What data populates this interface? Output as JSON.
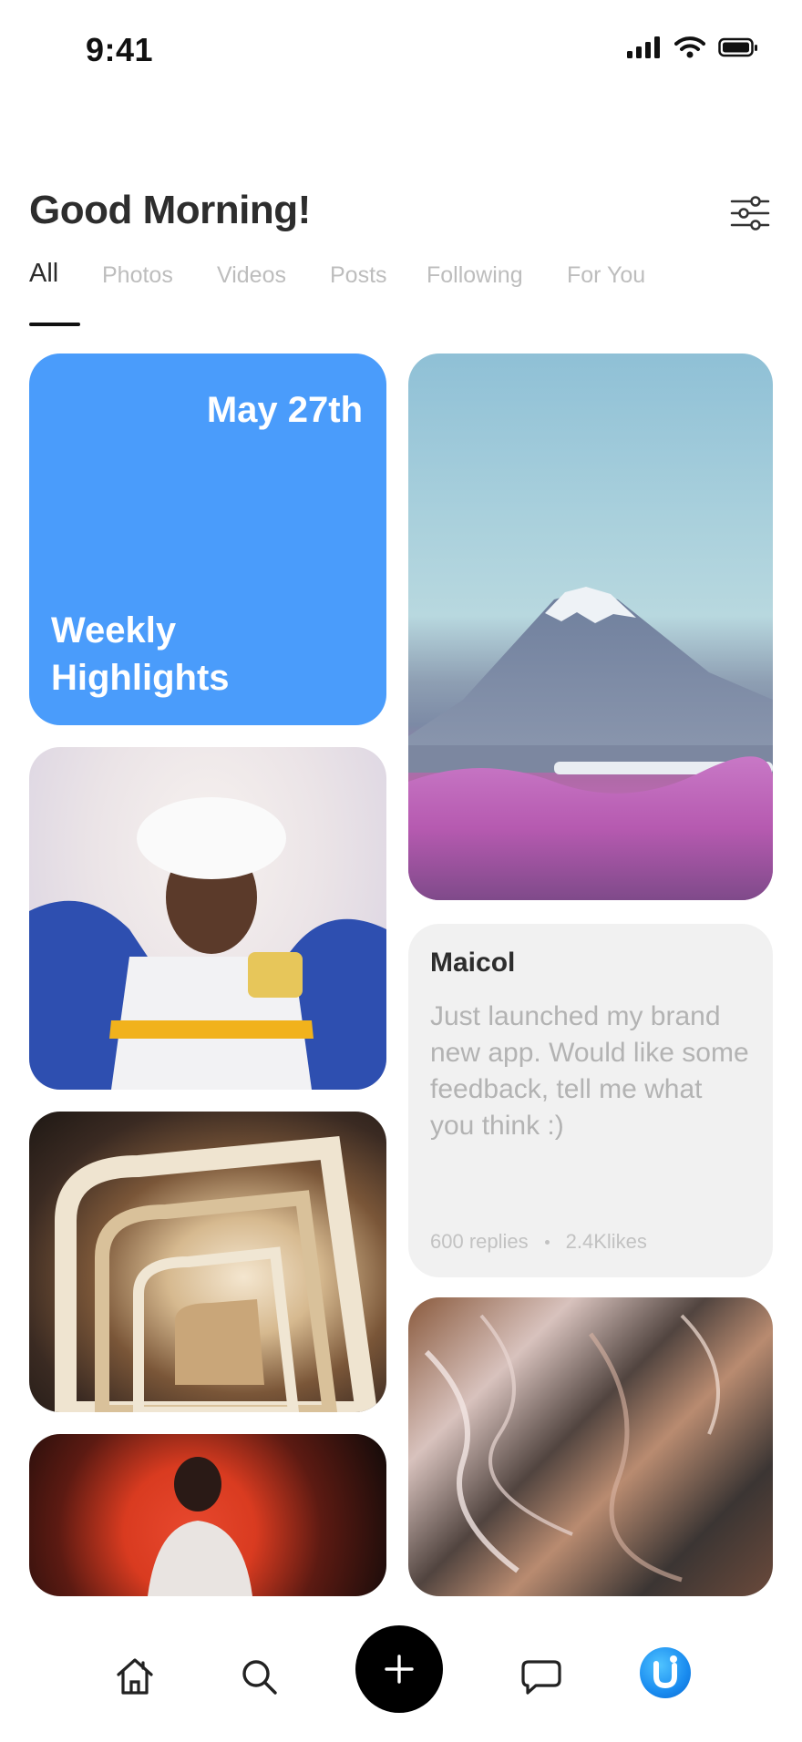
{
  "status_bar": {
    "time": "9:41"
  },
  "header": {
    "greeting": "Good Morning!"
  },
  "tabs": [
    {
      "label": "All",
      "active": true
    },
    {
      "label": "Photos",
      "active": false
    },
    {
      "label": "Videos",
      "active": false
    },
    {
      "label": "Posts",
      "active": false
    },
    {
      "label": "Following",
      "active": false
    },
    {
      "label": "For You",
      "active": false
    }
  ],
  "feed": {
    "highlight": {
      "date": "May 27th",
      "title_line1": "Weekly",
      "title_line2": "Highlights",
      "color": "#4a9cfb"
    },
    "post": {
      "author": "Maicol",
      "text": "Just launched my brand new app. Would like some feedback, tell me what you think :)",
      "replies": "600 replies",
      "likes": "2.4Klikes"
    }
  },
  "colors": {
    "accent": "#4a9cfb",
    "inactive_tab": "#bdbdbd",
    "add_button": "#000000"
  },
  "icons": [
    "signal-icon",
    "wifi-icon",
    "battery-icon",
    "filter-icon",
    "home-icon",
    "search-icon",
    "plus-icon",
    "chat-icon"
  ]
}
